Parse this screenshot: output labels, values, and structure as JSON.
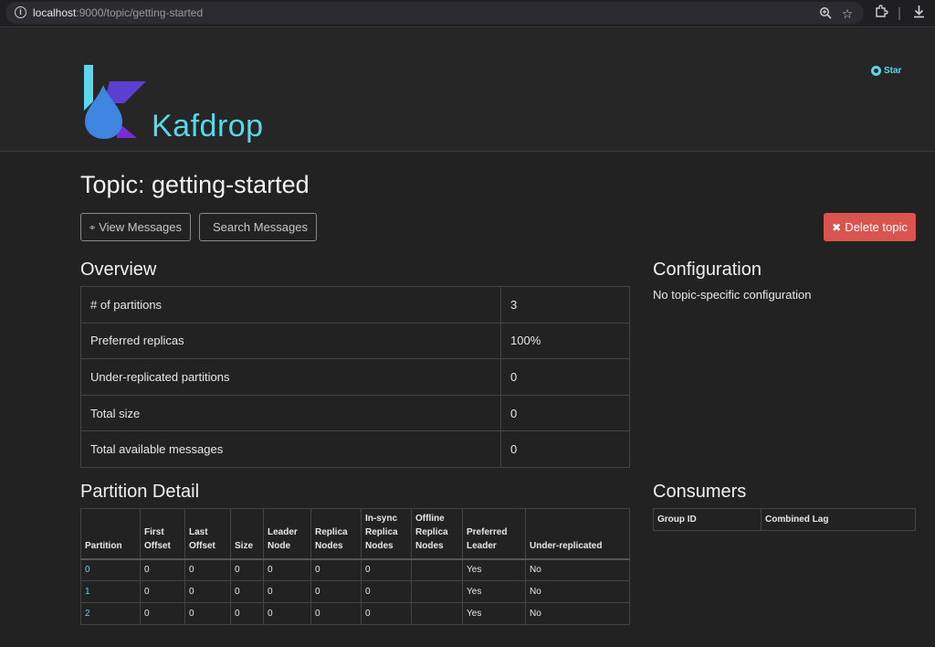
{
  "browser": {
    "url_host": "localhost",
    "url_path": ":9000/topic/getting-started"
  },
  "header": {
    "brand": "Kafdrop",
    "star_label": "Star"
  },
  "page": {
    "title": "Topic: getting-started",
    "view_messages": "View Messages",
    "search_messages": "Search Messages",
    "delete_topic": "Delete topic"
  },
  "overview": {
    "heading": "Overview",
    "rows": [
      {
        "label": "# of partitions",
        "value": "3"
      },
      {
        "label": "Preferred replicas",
        "value": "100%"
      },
      {
        "label": "Under-replicated partitions",
        "value": "0"
      },
      {
        "label": "Total size",
        "value": "0"
      },
      {
        "label": "Total available messages",
        "value": "0"
      }
    ]
  },
  "configuration": {
    "heading": "Configuration",
    "text": "No topic-specific configuration"
  },
  "partition_detail": {
    "heading": "Partition Detail",
    "columns": [
      "Partition",
      "First Offset",
      "Last Offset",
      "Size",
      "Leader Node",
      "Replica Nodes",
      "In-sync Replica Nodes",
      "Offline Replica Nodes",
      "Preferred Leader",
      "Under-replicated"
    ],
    "rows": [
      [
        "0",
        "0",
        "0",
        "0",
        "0",
        "0",
        "0",
        "",
        "Yes",
        "No"
      ],
      [
        "1",
        "0",
        "0",
        "0",
        "0",
        "0",
        "0",
        "",
        "Yes",
        "No"
      ],
      [
        "2",
        "0",
        "0",
        "0",
        "0",
        "0",
        "0",
        "",
        "Yes",
        "No"
      ]
    ]
  },
  "consumers": {
    "heading": "Consumers",
    "columns": [
      "Group ID",
      "Combined Lag"
    ]
  },
  "colors": {
    "accent": "#5bd6ea",
    "danger": "#d9534f",
    "background": "#222222"
  }
}
